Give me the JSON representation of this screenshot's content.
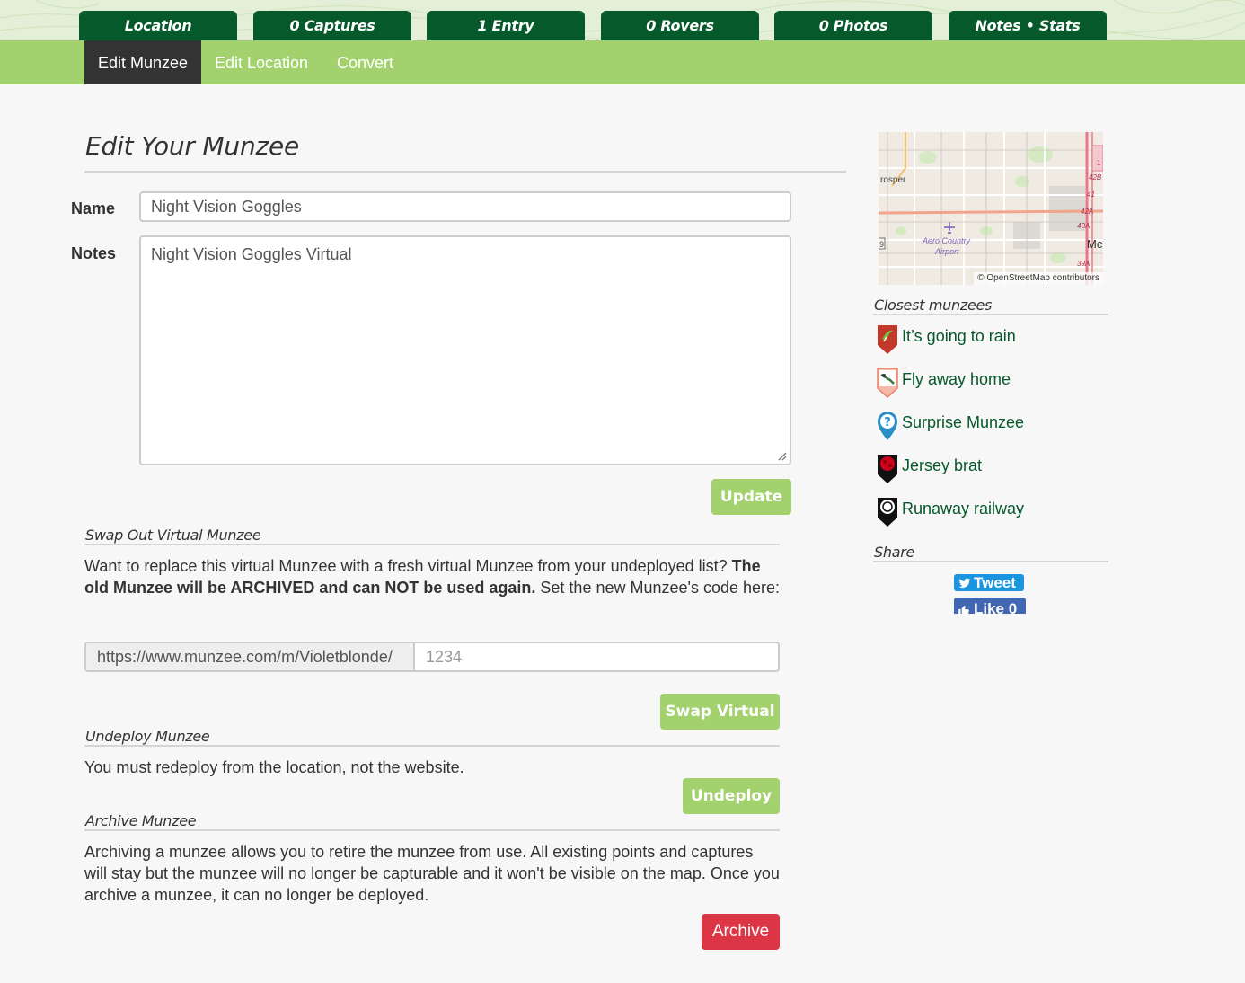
{
  "top_tabs": [
    {
      "label": "Location"
    },
    {
      "label": "0 Captures"
    },
    {
      "label": "1 Entry"
    },
    {
      "label": "0 Rovers"
    },
    {
      "label": "0 Photos"
    },
    {
      "label": "Notes • Stats"
    }
  ],
  "subnav": {
    "items": [
      {
        "label": "Edit Munzee",
        "active": true
      },
      {
        "label": "Edit Location",
        "active": false
      },
      {
        "label": "Convert",
        "active": false
      }
    ]
  },
  "form": {
    "title": "Edit Your Munzee",
    "name_label": "Name",
    "name_value": "Night Vision Goggles",
    "notes_label": "Notes",
    "notes_value": "Night Vision Goggles Virtual",
    "update_button": "Update"
  },
  "swap": {
    "title": "Swap Out Virtual Munzee",
    "text_1": "Want to replace this virtual Munzee with a fresh virtual Munzee from your undeployed list? ",
    "text_bold": "The old Munzee will be ARCHIVED and can NOT be used again.",
    "text_2": " Set the new Munzee's code here:",
    "url_prefix": "https://www.munzee.com/m/Violetblonde/",
    "code_placeholder": "1234",
    "button": "Swap Virtual"
  },
  "undeploy": {
    "title": "Undeploy Munzee",
    "text": "You must redeploy from the location, not the website.",
    "button": "Undeploy"
  },
  "archive": {
    "title": "Archive Munzee",
    "text": "Archiving a munzee allows you to retire the munzee from use. All existing points and captures will stay but the munzee will no longer be capturable and it won't be visible on the map. Once you archive a munzee, it can no longer be deployed.",
    "button": "Archive"
  },
  "sidebar": {
    "map": {
      "attribution": "© OpenStreetMap contributors",
      "labels": {
        "town": "rosper",
        "airport_1": "Aero Country",
        "airport_2": "Airport",
        "edge_mc": "Mc",
        "edge_9": "9",
        "exit_42b": "42B",
        "exit_41": "41",
        "exit_42a": "42A",
        "exit_40a": "40A",
        "exit_39a": "39A",
        "edge_1": "1"
      }
    },
    "closest_title": "Closest munzees",
    "closest": [
      {
        "name": "It’s going to rain",
        "icon": "rain-munzee-icon",
        "color": "#c0392b"
      },
      {
        "name": "Fly away home",
        "icon": "ladybug-munzee-icon",
        "color": "#e8826b"
      },
      {
        "name": "Surprise Munzee",
        "icon": "surprise-munzee-icon",
        "color": "#2a8fc7"
      },
      {
        "name": "Jersey brat",
        "icon": "jersey-brat-munzee-icon",
        "color": "#d0021b"
      },
      {
        "name": "Runaway railway",
        "icon": "railway-munzee-icon",
        "color": "#111111"
      }
    ],
    "share_title": "Share",
    "tweet_label": "Tweet",
    "like_label": "Like 0"
  },
  "colors": {
    "tab_green": "#06592b",
    "subnav_green": "#a3d16e",
    "button_green": "#a3d16e",
    "archive_red": "#dc3545",
    "link_green": "#06592b"
  }
}
